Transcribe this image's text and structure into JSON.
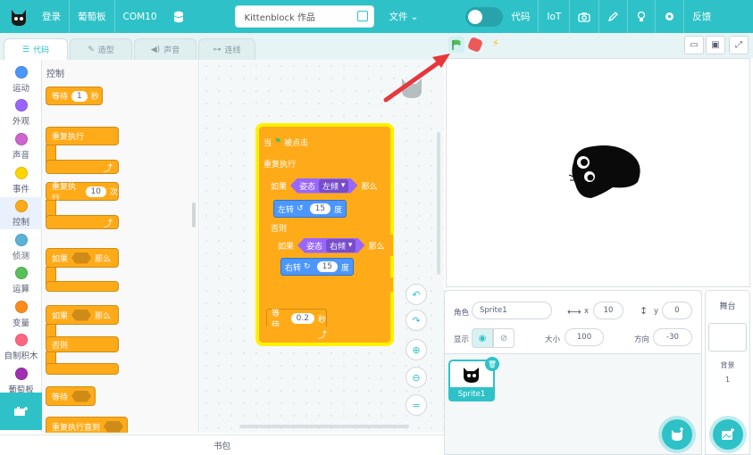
{
  "menubar": {
    "login": "登录",
    "board": "葡萄板",
    "port": "COM10",
    "project_title": "Kittenblock 作品",
    "file": "文件",
    "code": "代码",
    "iot": "IoT",
    "feedback": "反馈"
  },
  "tabs": {
    "code": "代码",
    "costumes": "造型",
    "sounds": "声音",
    "connect": "连线"
  },
  "categories": [
    {
      "label": "运动",
      "color": "#4c97ff"
    },
    {
      "label": "外观",
      "color": "#9966ff"
    },
    {
      "label": "声音",
      "color": "#cf63cf"
    },
    {
      "label": "事件",
      "color": "#ffd500"
    },
    {
      "label": "控制",
      "color": "#ffab19"
    },
    {
      "label": "侦测",
      "color": "#5cb1d6"
    },
    {
      "label": "运算",
      "color": "#59c059"
    },
    {
      "label": "变量",
      "color": "#ff8c1a"
    },
    {
      "label": "自制积木",
      "color": "#ff6680"
    },
    {
      "label": "葡萄板",
      "color": "#a02fb4"
    }
  ],
  "palette": {
    "heading": "控制",
    "wait": "等待",
    "wait_value": "1",
    "seconds": "秒",
    "forever": "重复执行",
    "repeat": "重复执行",
    "repeat_value": "10",
    "times": "次",
    "if": "如果",
    "then": "那么",
    "if2": "如果",
    "then2": "那么",
    "else": "否则",
    "wait_until": "等待",
    "repeat_until": "重复执行直到"
  },
  "script": {
    "when_flag": "当",
    "clicked": "被点击",
    "forever": "重复执行",
    "if1": "如果",
    "posture1": "姿态",
    "tilt_left": "左倾",
    "then1": "那么",
    "turn_left": "左转",
    "turn_left_value": "15",
    "degrees1": "度",
    "else": "否则",
    "if2": "如果",
    "posture2": "姿态",
    "tilt_right": "右倾",
    "then2": "那么",
    "turn_right": "右转",
    "turn_right_value": "15",
    "degrees2": "度",
    "wait": "等待",
    "wait_value": "0.2",
    "seconds": "秒"
  },
  "backpack": "书包",
  "sprite_info": {
    "sprite_label": "角色",
    "sprite_name": "Sprite1",
    "x_label": "x",
    "x_value": "10",
    "y_label": "y",
    "y_value": "0",
    "show_label": "显示",
    "size_label": "大小",
    "size_value": "100",
    "direction_label": "方向",
    "direction_value": "-30"
  },
  "sprite_list": [
    {
      "name": "Sprite1"
    }
  ],
  "stage_panel": {
    "title": "舞台",
    "backdrops_label": "背景",
    "backdrops_count": "1"
  },
  "colors": {
    "brand": "#2ec2c8",
    "control": "#ffab19",
    "motion": "#4c97ff",
    "sensing_board": "#9966ff",
    "highlight": "#fff200",
    "annotation_arrow": "#e8373c"
  }
}
